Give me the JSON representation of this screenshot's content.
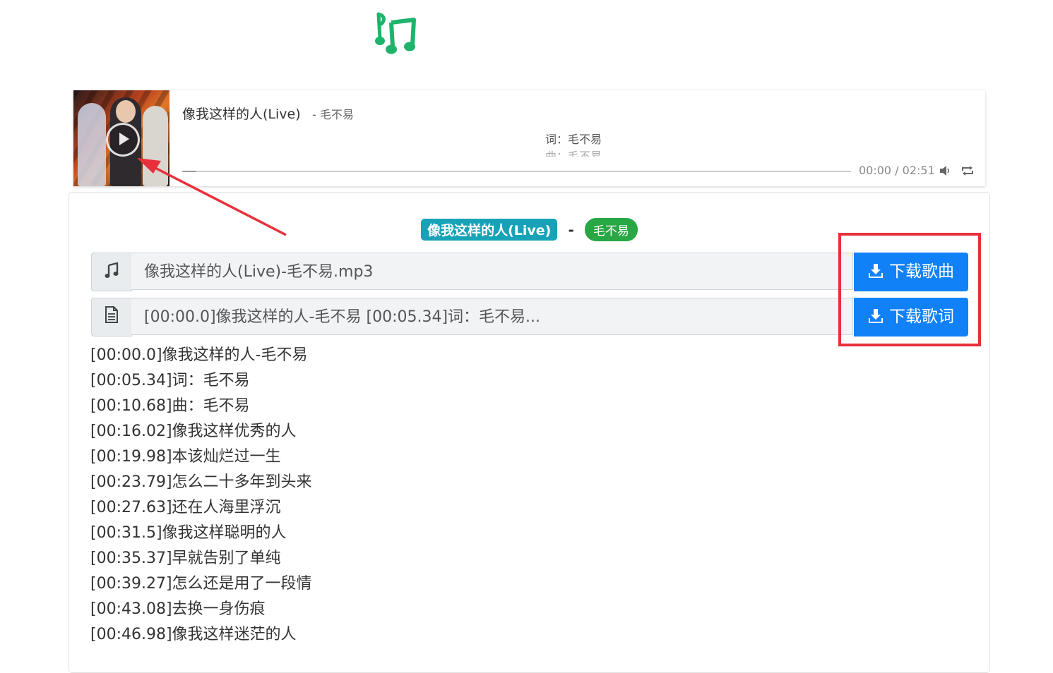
{
  "logo": {
    "icon": "music-notes-icon",
    "color": "#1fb36b"
  },
  "player": {
    "title": "像我这样的人(Live)",
    "artist": "- 毛不易",
    "lyric_current": "词：毛不易",
    "lyric_next": "曲：毛不易",
    "time": "00:00 / 02:51",
    "play_icon": "play-icon",
    "volume_icon": "volume-icon",
    "loop_icon": "loop-icon"
  },
  "tags": {
    "title": "像我这样的人(Live)",
    "separator": "-",
    "artist": "毛不易",
    "title_color": "#17a2b8",
    "artist_color": "#28a745"
  },
  "song_row": {
    "icon": "music-note-icon",
    "filename": "像我这样的人(Live)-毛不易.mp3",
    "button": "下载歌曲"
  },
  "lyric_row": {
    "icon": "document-icon",
    "preview": "[00:00.0]像我这样的人-毛不易 [00:05.34]词：毛不易...",
    "button": "下载歌词"
  },
  "lyrics": [
    "[00:00.0]像我这样的人-毛不易",
    "[00:05.34]词：毛不易",
    "[00:10.68]曲：毛不易",
    "[00:16.02]像我这样优秀的人",
    "[00:19.98]本该灿烂过一生",
    "[00:23.79]怎么二十多年到头来",
    "[00:27.63]还在人海里浮沉",
    "[00:31.5]像我这样聪明的人",
    "[00:35.37]早就告别了单纯",
    "[00:39.27]怎么还是用了一段情",
    "[00:43.08]去换一身伤痕",
    "[00:46.98]像我这样迷茫的人"
  ],
  "colors": {
    "button": "#1181f8",
    "annotation": "#e8303a"
  }
}
